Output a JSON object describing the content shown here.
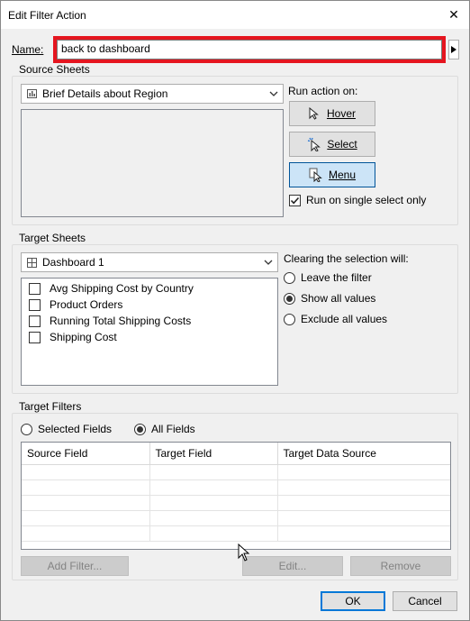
{
  "window": {
    "title": "Edit Filter Action",
    "close_glyph": "✕"
  },
  "name": {
    "label": "Name:",
    "value": "back to dashboard"
  },
  "source_sheets": {
    "title": "Source Sheets",
    "selected_sheet": "Brief Details about Region",
    "run_action_label": "Run action on:",
    "buttons": {
      "hover": "Hover",
      "select": "Select",
      "menu": "Menu"
    },
    "active_trigger": "Menu",
    "single_select_label": "Run on single select only",
    "single_select_checked": true
  },
  "target_sheets": {
    "title": "Target Sheets",
    "selected_dashboard": "Dashboard 1",
    "sheets": [
      {
        "label": "Avg Shipping Cost by Country",
        "checked": false
      },
      {
        "label": "Product Orders",
        "checked": false
      },
      {
        "label": "Running Total Shipping Costs",
        "checked": false
      },
      {
        "label": "Shipping Cost",
        "checked": false
      }
    ],
    "clearing_label": "Clearing the selection will:",
    "clear_options": [
      {
        "label": "Leave the filter",
        "selected": false
      },
      {
        "label": "Show all values",
        "selected": true
      },
      {
        "label": "Exclude all values",
        "selected": false
      }
    ]
  },
  "target_filters": {
    "title": "Target Filters",
    "scope_options": [
      {
        "label": "Selected Fields",
        "selected": false
      },
      {
        "label": "All Fields",
        "selected": true
      }
    ],
    "columns": [
      "Source Field",
      "Target Field",
      "Target Data Source"
    ],
    "add_filter_label": "Add Filter...",
    "edit_label": "Edit...",
    "remove_label": "Remove"
  },
  "footer": {
    "ok_label": "OK",
    "cancel_label": "Cancel"
  },
  "colors": {
    "highlight": "#e5151f",
    "accent": "#0078d7",
    "pressed": "#cce4f7"
  }
}
